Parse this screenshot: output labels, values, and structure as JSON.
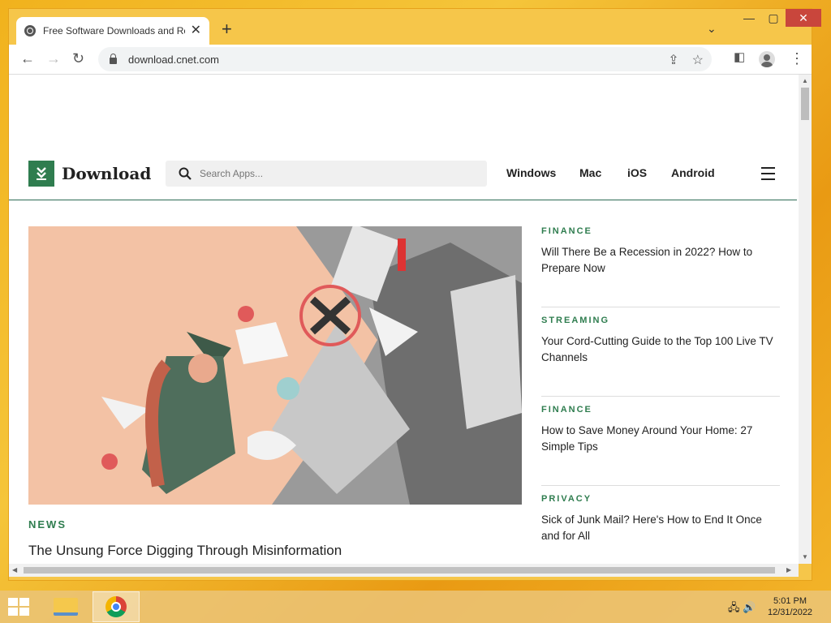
{
  "browser": {
    "tab_title": "Free Software Downloads and Re",
    "url": "download.cnet.com",
    "window_controls": [
      "minimize",
      "maximize",
      "close"
    ]
  },
  "site": {
    "logo_text": "Download",
    "search_placeholder": "Search Apps...",
    "nav": [
      "Windows",
      "Mac",
      "iOS",
      "Android"
    ]
  },
  "hero": {
    "kicker": "NEWS",
    "title": "The Unsung Force Digging Through Misinformation"
  },
  "sidebar": [
    {
      "kicker": "FINANCE",
      "headline": "Will There Be a Recession in 2022? How to Prepare Now"
    },
    {
      "kicker": "STREAMING",
      "headline": "Your Cord-Cutting Guide to the Top 100 Live TV Channels"
    },
    {
      "kicker": "FINANCE",
      "headline": "How to Save Money Around Your Home: 27 Simple Tips"
    },
    {
      "kicker": "PRIVACY",
      "headline": "Sick of Junk Mail? Here's How to End It Once and for All"
    }
  ],
  "taskbar": {
    "time": "5:01 PM",
    "date": "12/31/2022"
  },
  "colors": {
    "brand_green": "#2f7d4f",
    "hero_bg": "#f3c2a5",
    "close_red": "#c9463c"
  }
}
